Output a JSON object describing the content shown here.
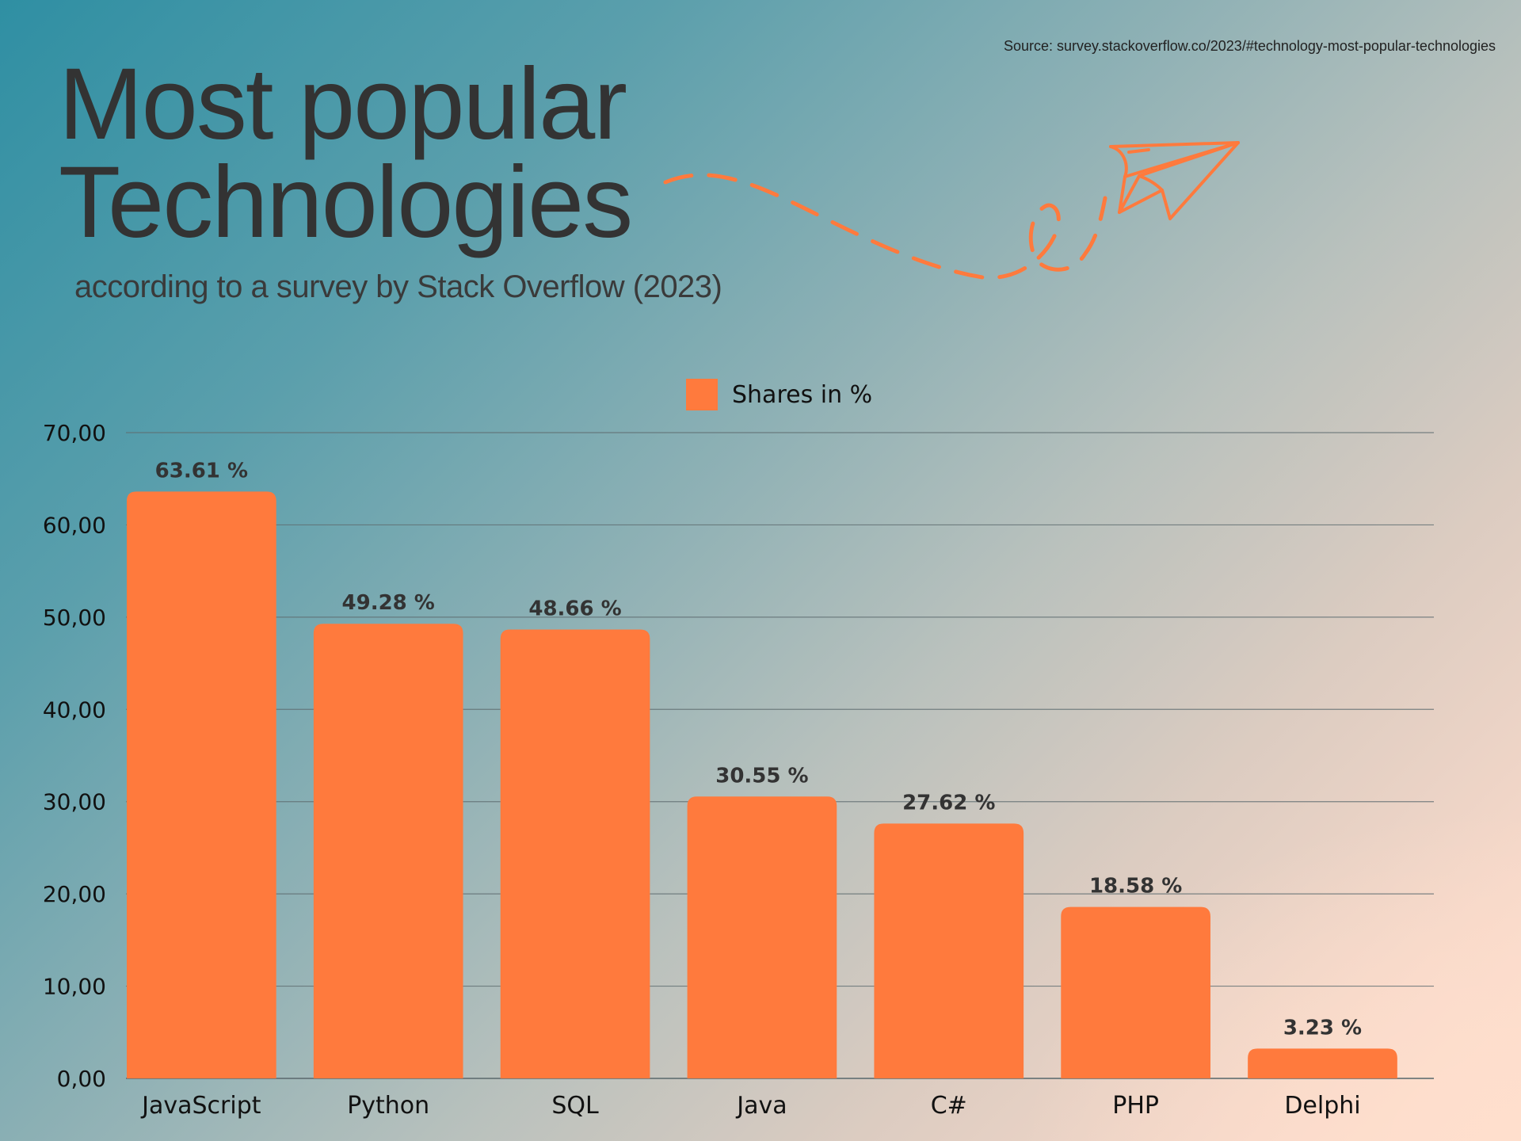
{
  "source": "Source: survey.stackoverflow.co/2023/#technology-most-popular-technologies",
  "title_lines": [
    "Most popular",
    "Technologies"
  ],
  "subtitle": "according to a survey by Stack Overflow (2023)",
  "colors": {
    "bar": "#ff7a3d",
    "decoration": "#ff7a3d",
    "text_dark": "#333333",
    "gridline": "#5f6d70"
  },
  "decoration": {
    "icon": "paper-plane-icon",
    "trail": "dashed-loop-trail"
  },
  "chart_data": {
    "type": "bar",
    "title": "Most popular Technologies",
    "subtitle": "according to a survey by Stack Overflow (2023)",
    "xlabel": "",
    "ylabel": "",
    "legend": {
      "entries": [
        "Shares in %"
      ],
      "placement": "top-center"
    },
    "categories": [
      "JavaScript",
      "Python",
      "SQL",
      "Java",
      "C#",
      "PHP",
      "Delphi"
    ],
    "series": [
      {
        "name": "Shares in %",
        "values": [
          63.61,
          49.28,
          48.66,
          30.55,
          27.62,
          18.58,
          3.23
        ]
      }
    ],
    "data_labels": [
      "63.61 %",
      "49.28 %",
      "48.66 %",
      "30.55 %",
      "27.62 %",
      "18.58 %",
      "3.23 %"
    ],
    "ylim": [
      0,
      70
    ],
    "yticks": [
      0,
      10,
      20,
      30,
      40,
      50,
      60,
      70
    ],
    "ytick_labels": [
      "0,00",
      "10,00",
      "20,00",
      "30,00",
      "40,00",
      "50,00",
      "60,00",
      "70,00"
    ],
    "grid": true
  }
}
